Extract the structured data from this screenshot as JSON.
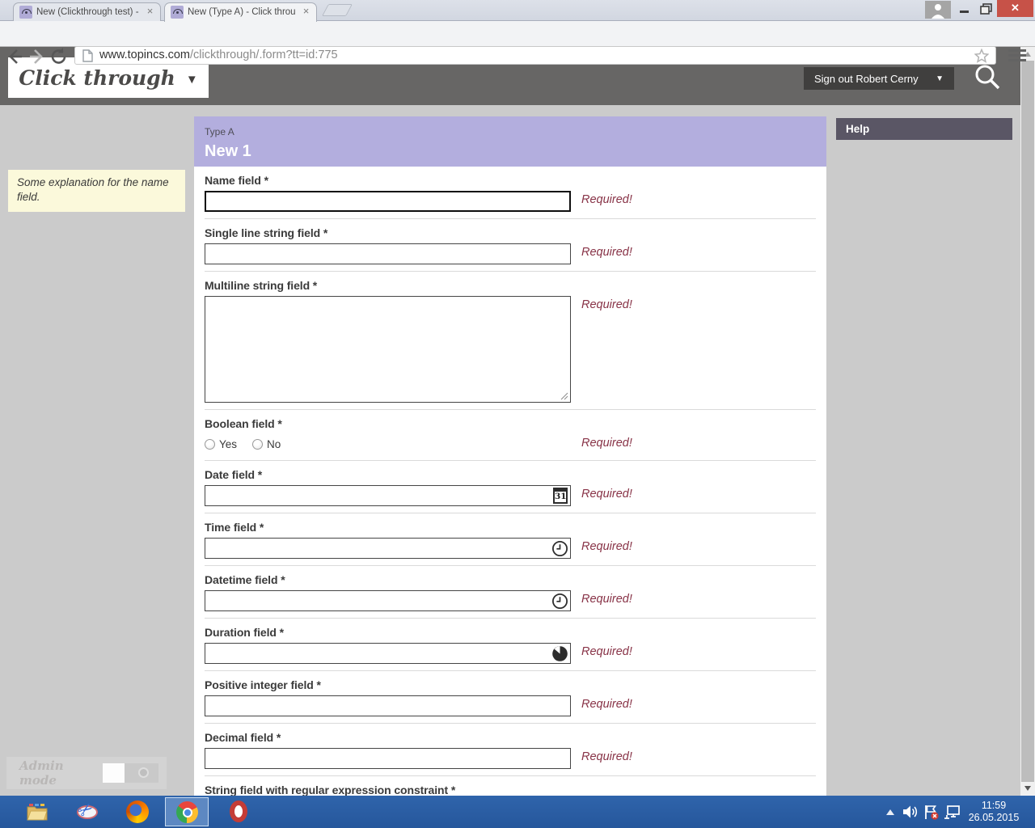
{
  "browser": {
    "tab1": {
      "title": "New (Clickthrough test) - "
    },
    "tab2": {
      "title": "New (Type A) - Click throu"
    },
    "close_glyph": "×",
    "window_close_glyph": "✕",
    "url": {
      "domain": "www.topincs.com",
      "path": "/clickthrough/.form?tt=id:775"
    }
  },
  "header": {
    "logo_text": "Click through",
    "dropdown_glyph": "▼",
    "signout_label": "Sign out Robert Cerny"
  },
  "sidebar": {
    "note_text": "Some explanation for the name field.",
    "admin_mode_label": "Admin mode"
  },
  "form": {
    "type_label": "Type A",
    "title": "New 1",
    "required_text": "Required!",
    "calendar_day": "31",
    "boolean_yes": "Yes",
    "boolean_no": "No",
    "fields": [
      {
        "label": "Name field *"
      },
      {
        "label": "Single line string field *"
      },
      {
        "label": "Multiline string field *"
      },
      {
        "label": "Boolean field *"
      },
      {
        "label": "Date field *"
      },
      {
        "label": "Time field *"
      },
      {
        "label": "Datetime field *"
      },
      {
        "label": "Duration field *"
      },
      {
        "label": "Positive integer field *"
      },
      {
        "label": "Decimal field *"
      },
      {
        "label": "String field with regular expression constraint *"
      }
    ]
  },
  "help": {
    "title": "Help"
  },
  "taskbar": {
    "time": "11:59",
    "date": "26.05.2015"
  }
}
